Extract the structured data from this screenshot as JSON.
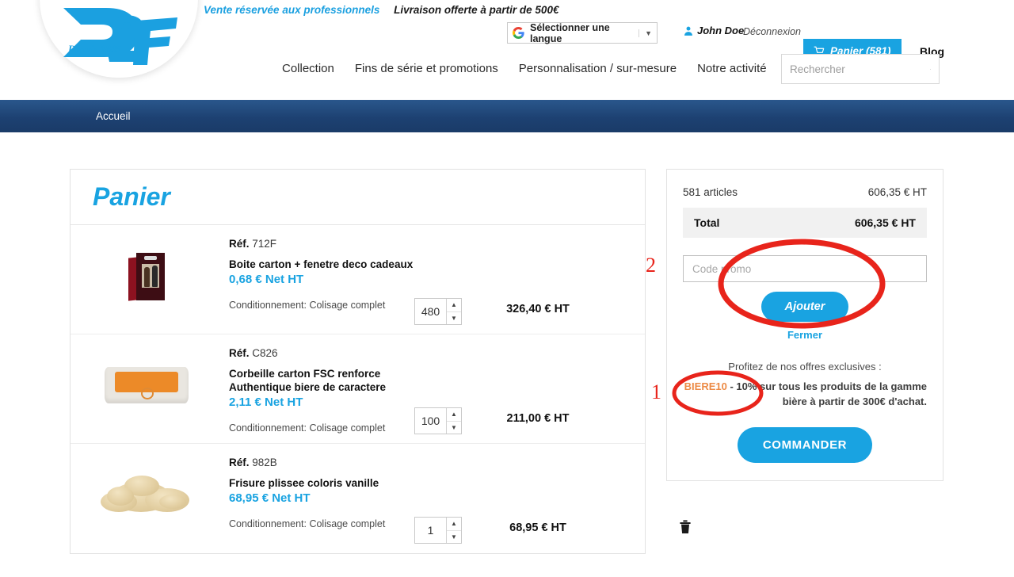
{
  "header": {
    "banner_pro": "Vente réservée aux professionnels",
    "banner_shipping": "Livraison offerte à partir de 500€",
    "translate_label": "Sélectionner une langue",
    "translate_caret": "▼",
    "user_name": "John Doe",
    "logout_label": "Déconnexion",
    "cart_label": "Panier (581)",
    "blog_label": "Blog",
    "logo_tagline": "Depuis 1845"
  },
  "nav": {
    "items": [
      {
        "label": "Collection"
      },
      {
        "label": "Fins de série et promotions"
      },
      {
        "label": "Personnalisation / sur-mesure"
      },
      {
        "label": "Notre activité"
      }
    ],
    "search_placeholder": "Rechercher",
    "search_value": ""
  },
  "breadcrumb": {
    "items": [
      {
        "label": "Accueil"
      }
    ]
  },
  "cart": {
    "title": "Panier",
    "rows": [
      {
        "ref_label": "Réf.",
        "ref_value": "712F",
        "name": "Boite carton + fenetre deco cadeaux",
        "unit_price": "0,68 € Net HT",
        "packaging": "Conditionnement: Colisage complet",
        "qty": "480",
        "line_total": "326,40 € HT"
      },
      {
        "ref_label": "Réf.",
        "ref_value": "C826",
        "name": "Corbeille carton FSC renforce\nAuthentique biere de caractere",
        "unit_price": "2,11 € Net HT",
        "packaging": "Conditionnement: Colisage complet",
        "qty": "100",
        "line_total": "211,00 € HT"
      },
      {
        "ref_label": "Réf.",
        "ref_value": "982B",
        "name": "Frisure plissee coloris vanille",
        "unit_price": "68,95 € Net HT",
        "packaging": "Conditionnement: Colisage complet",
        "qty": "1",
        "line_total": "68,95 € HT"
      }
    ]
  },
  "summary": {
    "articles_label": "581 articles",
    "articles_amount": "606,35 € HT",
    "total_label": "Total",
    "total_amount": "606,35 € HT",
    "promo_placeholder": "Code promo",
    "promo_value": "",
    "add_button": "Ajouter",
    "close_link": "Fermer",
    "offers_intro": "Profitez de nos offres exclusives :",
    "offer_code": "BIERE10",
    "offer_text": " - 10% sur tous les produits de la gamme bière à partir de 300€ d'achat.",
    "order_button": "COMMANDER"
  },
  "annotations": {
    "marker_one": "1",
    "marker_two": "2",
    "color": "#e8241b"
  },
  "theme": {
    "accent_blue": "#19a3e1",
    "breadcrumb_blue": "#1d4172",
    "offer_orange": "#ec8a45"
  }
}
